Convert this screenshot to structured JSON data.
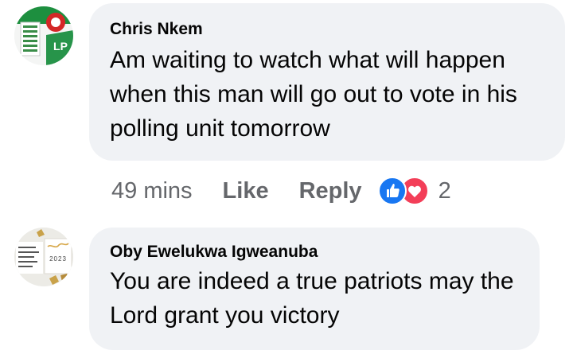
{
  "comments": [
    {
      "author": "Chris Nkem",
      "text": "Am waiting to watch what will happen when this man will go out to vote in his polling unit tomorrow",
      "avatar_badge": "LP",
      "meta": {
        "time": "49 mins",
        "like_label": "Like",
        "reply_label": "Reply",
        "reaction_count": "2",
        "reaction_icons": [
          "like-icon",
          "love-icon"
        ]
      }
    },
    {
      "author": "Oby Ewelukwa Igweanuba",
      "text": "You are indeed a true patriots may the Lord grant you victory",
      "avatar_year": "2023"
    }
  ],
  "colors": {
    "bubble": "#f0f2f5",
    "meta_text": "#65676b",
    "like_blue": "#1877f2",
    "love_red": "#f33e58"
  }
}
